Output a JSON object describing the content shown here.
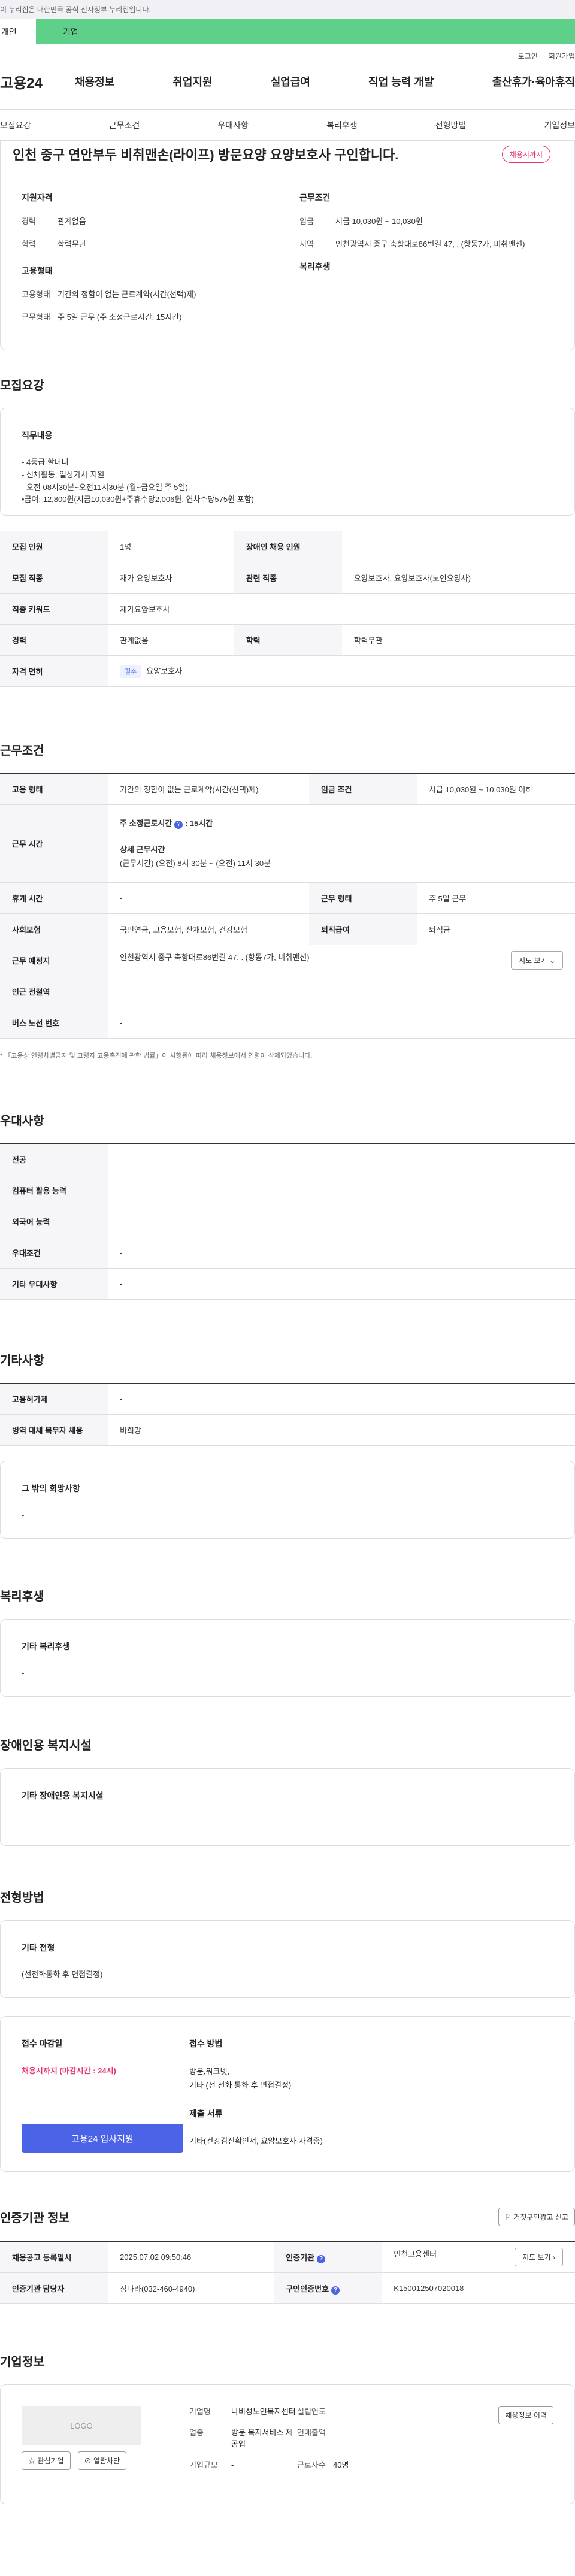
{
  "banner": {
    "text": "이 누리집은 대한민국 공식 전자정부 누리집입니다."
  },
  "tabs": {
    "personal": "개인",
    "business": "기업"
  },
  "util": {
    "login": "로그인",
    "signup": "회원가입"
  },
  "gnb": {
    "logo": "고용24",
    "menu": [
      "채용정보",
      "취업지원",
      "실업급여",
      "직업 능력 개발",
      "출산휴가·육아휴직"
    ]
  },
  "subnav": [
    "모집요강",
    "근무조건",
    "우대사항",
    "복리후생",
    "전형방법",
    "기업정보"
  ],
  "job": {
    "title": "인천 중구 연안부두 비취맨손(라이프) 방문요양 요양보호사 구인합니다.",
    "status": "채용시까지",
    "qual_title": "지원자격",
    "qual_rows": [
      {
        "k": "경력",
        "v": "관계없음"
      },
      {
        "k": "학력",
        "v": "학력무관"
      }
    ],
    "cond_title": "근무조건",
    "cond_rows": [
      {
        "k": "임금",
        "v": "시급 10,030원 ~ 10,030원"
      },
      {
        "k": "지역",
        "v": "인천광역시 중구 축항대로86번길 47, . (항동7가, 비취맨션)"
      }
    ],
    "emp_title": "고용형태",
    "emp_rows": [
      {
        "k": "고용형태",
        "v": "기간의 정함이 없는 근로계약(시간(선택)제)"
      },
      {
        "k": "근무형태",
        "v": "주 5일 근무 (주 소정근로시간: 15시간)"
      }
    ],
    "welfare_title": "복리후생"
  },
  "recruit": {
    "title": "모집요강",
    "duty_title": "직무내용",
    "duty_lines": [
      "- 4등급 할머니",
      "- 신체활동, 일상가사 지원",
      "- 오전 08시30분~오전11시30분 (월~금요일 주 5일).",
      "•급여: 12,800원(시급10,030원+주휴수당2,006원, 연차수당575원 포함)"
    ],
    "rows": [
      {
        "k1": "모집 인원",
        "v1": "1명",
        "k2": "장애인 채용 인원",
        "v2": "-"
      },
      {
        "k1": "모집 직종",
        "v1": "재가 요양보호사",
        "k2": "관련 직종",
        "v2": "요양보호사, 요양보호사(노인요양사)"
      }
    ],
    "keyword": {
      "k": "직종 키워드",
      "v": "재가요양보호사"
    },
    "career": {
      "k1": "경력",
      "v1": "관계없음",
      "k2": "학력",
      "v2": "학력무관"
    },
    "license": {
      "k": "자격 면허",
      "tag": "필수",
      "v": "요양보호사"
    }
  },
  "work": {
    "title": "근무조건",
    "type": {
      "k1": "고용 형태",
      "v1": "기간의 정함이 없는 근로계약(시간(선택)제)",
      "k2": "임금 조건",
      "v2": "시급 10,030원 ~ 10,030원 이하"
    },
    "hours": {
      "k": "근무 시간",
      "week": "주 소정근로시간",
      "week_val": ": 15시간",
      "detail_title": "상세 근무시간",
      "detail": "(근무시간) (오전) 8시 30분 ~ (오전) 11시 30분"
    },
    "rest": {
      "k1": "휴게 시간",
      "v1": "-",
      "k2": "근무 형태",
      "v2": "주 5일 근무"
    },
    "insurance": {
      "k1": "사회보험",
      "v1": "국민연금, 고용보험, 산재보험, 건강보험",
      "k2": "퇴직급여",
      "v2": "퇴직금"
    },
    "place": {
      "k": "근무 예정지",
      "v": "인천광역시 중구 축항대로86번길 47, . (항동7가, 비취맨션)",
      "btn": "지도 보기"
    },
    "subway": {
      "k": "인근 전철역",
      "v": "-"
    },
    "bus": {
      "k": "버스 노선 번호",
      "v": "-"
    },
    "note": "* 「고용상 연령차별금지 및 고령자 고용촉진에 관한 법률」이 시행됨에 따라 채용정보에서 연령이 삭제되었습니다."
  },
  "prefer": {
    "title": "우대사항",
    "rows": [
      {
        "k": "전공",
        "v": "-"
      },
      {
        "k": "컴퓨터 활용 능력",
        "v": "-"
      },
      {
        "k": "외국어 능력",
        "v": "-"
      },
      {
        "k": "우대조건",
        "v": "-"
      },
      {
        "k": "기타 우대사항",
        "v": "-"
      }
    ]
  },
  "etc": {
    "title": "기타사항",
    "rows": [
      {
        "k": "고용허가제",
        "v": "-"
      },
      {
        "k": "병역 대체 복무자 채용",
        "v": "비희망"
      }
    ],
    "wish_title": "그 밖의 희망사항",
    "wish_val": "-"
  },
  "benefit": {
    "title": "복리후생",
    "box_title": "기타 복리후생",
    "box_val": "-"
  },
  "disabled": {
    "title": "장애인용 복지시설",
    "box_title": "기타 장애인용 복지시설",
    "box_val": "-"
  },
  "selection": {
    "title": "전형방법",
    "box_title": "기타 전형",
    "box_val": "(선전화통화 후 면접결정)",
    "deadline_title": "접수 마감일",
    "deadline": "채용시까지 (마감시간 : 24시)",
    "method_title": "접수 방법",
    "method_lines": [
      "방문,워크넷,",
      "기타 (선 전화 통화 후 면접결정)"
    ],
    "docs_title": "제출 서류",
    "docs_val": "기타(건강검진확인서, 요양보호사 자격증)",
    "apply_btn": "고용24 입사지원"
  },
  "cert": {
    "title": "인증기관 정보",
    "report_btn": "거짓구인광고 신고",
    "date_k": "채용공고 등록일시",
    "date_v": "2025.07.02 09:50:46",
    "org_k": "인증기관",
    "org_v": "인천고용센터",
    "map_btn": "지도 보기",
    "mgr_k": "인증기관 담당자",
    "mgr_v": "정나라(032-460-4940)",
    "no_k": "구인인증번호",
    "no_v": "K150012507020018"
  },
  "company": {
    "title": "기업정보",
    "logo": "LOGO",
    "fav_btn": "관심기업",
    "block_btn": "열람차단",
    "fields": [
      {
        "k": "기업명",
        "v": "나비성노인복지센터"
      },
      {
        "k": "설립연도",
        "v": "-"
      },
      {
        "k": "업종",
        "v": "방문 복지서비스 제공업"
      },
      {
        "k": "연매출액",
        "v": "-"
      },
      {
        "k": "기업규모",
        "v": "-"
      },
      {
        "k": "근로자수",
        "v": "40명"
      }
    ],
    "history_btn": "채용정보 이력"
  }
}
